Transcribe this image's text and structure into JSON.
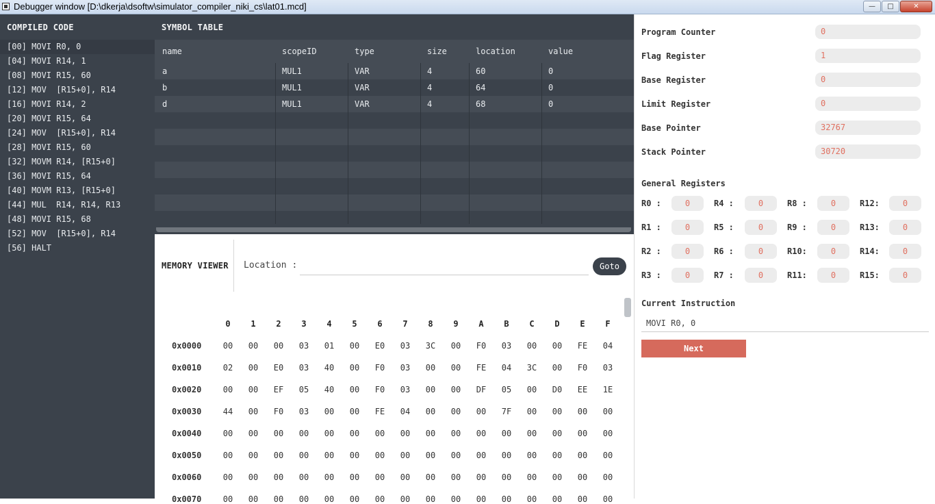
{
  "window": {
    "title": "Debugger window [D:\\dkerja\\dsoftw\\simulator_compiler_niki_cs\\lat01.mcd]",
    "minimize_label": "—",
    "maximize_label": "□",
    "close_label": "✕"
  },
  "compiled_code": {
    "title": "COMPILED CODE",
    "lines": [
      "[00] MOVI R0, 0",
      "[04] MOVI R14, 1",
      "[08] MOVI R15, 60",
      "[12] MOV  [R15+0], R14",
      "[16] MOVI R14, 2",
      "[20] MOVI R15, 64",
      "[24] MOV  [R15+0], R14",
      "[28] MOVI R15, 60",
      "[32] MOVM R14, [R15+0]",
      "[36] MOVI R15, 64",
      "[40] MOVM R13, [R15+0]",
      "[44] MUL  R14, R14, R13",
      "[48] MOVI R15, 68",
      "[52] MOV  [R15+0], R14",
      "[56] HALT"
    ]
  },
  "symbol_table": {
    "title": "SYMBOL TABLE",
    "columns": [
      "name",
      "scopeID",
      "type",
      "size",
      "location",
      "value"
    ],
    "rows": [
      [
        "a",
        "MUL1",
        "VAR",
        "4",
        "60",
        "0"
      ],
      [
        "b",
        "MUL1",
        "VAR",
        "4",
        "64",
        "0"
      ],
      [
        "d",
        "MUL1",
        "VAR",
        "4",
        "68",
        "0"
      ]
    ]
  },
  "memory_viewer": {
    "title": "MEMORY VIEWER",
    "location_label": "Location :",
    "location_value": "",
    "goto_label": "Goto",
    "columns": [
      "0",
      "1",
      "2",
      "3",
      "4",
      "5",
      "6",
      "7",
      "8",
      "9",
      "A",
      "B",
      "C",
      "D",
      "E",
      "F"
    ],
    "rows": [
      {
        "address": "0x0000",
        "bytes": [
          "00",
          "00",
          "00",
          "03",
          "01",
          "00",
          "E0",
          "03",
          "3C",
          "00",
          "F0",
          "03",
          "00",
          "00",
          "FE",
          "04"
        ]
      },
      {
        "address": "0x0010",
        "bytes": [
          "02",
          "00",
          "E0",
          "03",
          "40",
          "00",
          "F0",
          "03",
          "00",
          "00",
          "FE",
          "04",
          "3C",
          "00",
          "F0",
          "03"
        ]
      },
      {
        "address": "0x0020",
        "bytes": [
          "00",
          "00",
          "EF",
          "05",
          "40",
          "00",
          "F0",
          "03",
          "00",
          "00",
          "DF",
          "05",
          "00",
          "D0",
          "EE",
          "1E"
        ]
      },
      {
        "address": "0x0030",
        "bytes": [
          "44",
          "00",
          "F0",
          "03",
          "00",
          "00",
          "FE",
          "04",
          "00",
          "00",
          "00",
          "7F",
          "00",
          "00",
          "00",
          "00"
        ]
      },
      {
        "address": "0x0040",
        "bytes": [
          "00",
          "00",
          "00",
          "00",
          "00",
          "00",
          "00",
          "00",
          "00",
          "00",
          "00",
          "00",
          "00",
          "00",
          "00",
          "00"
        ]
      },
      {
        "address": "0x0050",
        "bytes": [
          "00",
          "00",
          "00",
          "00",
          "00",
          "00",
          "00",
          "00",
          "00",
          "00",
          "00",
          "00",
          "00",
          "00",
          "00",
          "00"
        ]
      },
      {
        "address": "0x0060",
        "bytes": [
          "00",
          "00",
          "00",
          "00",
          "00",
          "00",
          "00",
          "00",
          "00",
          "00",
          "00",
          "00",
          "00",
          "00",
          "00",
          "00"
        ]
      },
      {
        "address": "0x0070",
        "bytes": [
          "00",
          "00",
          "00",
          "00",
          "00",
          "00",
          "00",
          "00",
          "00",
          "00",
          "00",
          "00",
          "00",
          "00",
          "00",
          "00"
        ]
      }
    ]
  },
  "registers": {
    "special": [
      {
        "label": "Program Counter",
        "value": "0"
      },
      {
        "label": "Flag Register",
        "value": "1"
      },
      {
        "label": "Base Register",
        "value": "0"
      },
      {
        "label": "Limit Register",
        "value": "0"
      },
      {
        "label": "Base Pointer",
        "value": "32767"
      },
      {
        "label": "Stack Pointer",
        "value": "30720"
      }
    ],
    "general_title": "General Registers",
    "general": [
      {
        "label": "R0 :",
        "value": "0"
      },
      {
        "label": "R4 :",
        "value": "0"
      },
      {
        "label": "R8 :",
        "value": "0"
      },
      {
        "label": "R12:",
        "value": "0"
      },
      {
        "label": "R1 :",
        "value": "0"
      },
      {
        "label": "R5 :",
        "value": "0"
      },
      {
        "label": "R9 :",
        "value": "0"
      },
      {
        "label": "R13:",
        "value": "0"
      },
      {
        "label": "R2 :",
        "value": "0"
      },
      {
        "label": "R6 :",
        "value": "0"
      },
      {
        "label": "R10:",
        "value": "0"
      },
      {
        "label": "R14:",
        "value": "0"
      },
      {
        "label": "R3 :",
        "value": "0"
      },
      {
        "label": "R7 :",
        "value": "0"
      },
      {
        "label": "R11:",
        "value": "0"
      },
      {
        "label": "R15:",
        "value": "0"
      }
    ]
  },
  "current_instruction": {
    "title": "Current Instruction",
    "value": "MOVI R0, 0"
  },
  "next_label": "Next"
}
